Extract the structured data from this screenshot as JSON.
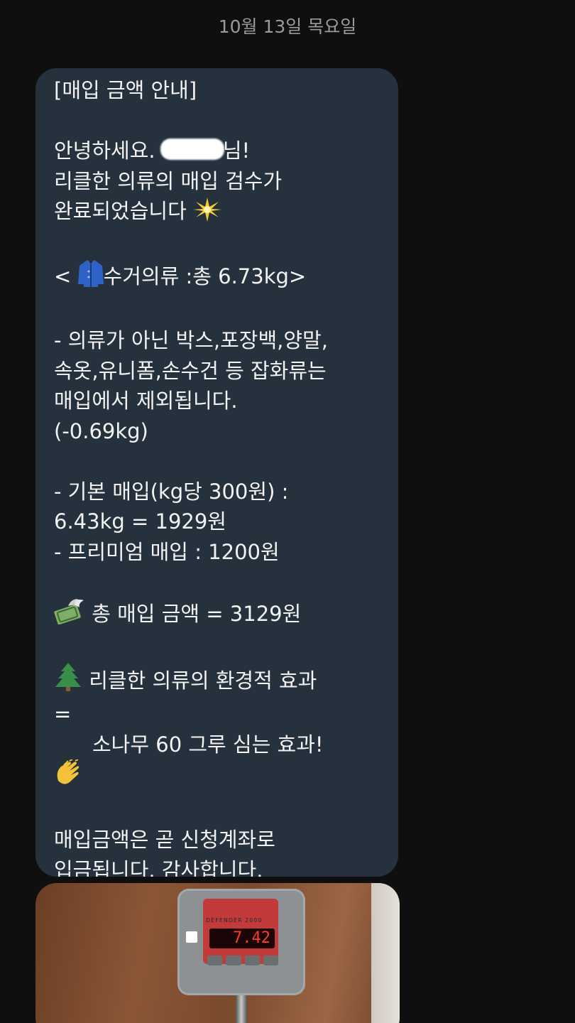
{
  "date_header": "10월 13일 목요일",
  "message": {
    "title": "[매입 금액 안내]",
    "greeting_prefix": "안녕하세요. ",
    "greeting_suffix": "님!",
    "line_review_1": "리클한 의류의 매입 검수가",
    "line_review_2": "완료되었습니다 ",
    "collected": "< ",
    "collected_text": "수거의류 :총 6.73kg>",
    "excluded_1": "- 의류가 아닌 박스,포장백,양말,",
    "excluded_2": "속옷,유니폼,손수건 등 잡화류는",
    "excluded_3": "매입에서 제외됩니다.",
    "excluded_4": "(-0.69kg)",
    "basic_1": "- 기본 매입(kg당 300원) :",
    "basic_2": "6.43kg = 1929원",
    "premium": "- 프리미엄 매입 : 1200원",
    "total": " 총 매입 금액 = 3129원",
    "eco_1": " 리클한 의류의 환경적 효과",
    "eco_2": "=",
    "eco_3": "소나무 60 그루 심는 효과!",
    "deposit_1": "매입금액은 곧 신청계좌로",
    "deposit_2": "입금됩니다. 감사합니다."
  },
  "icons": {
    "sparkle": "sparkle-icon",
    "jacket": "jacket-icon",
    "money": "money-with-wings-icon",
    "tree": "evergreen-tree-icon",
    "clap": "clapping-hands-icon"
  },
  "photo": {
    "brand": "DEFENDER 2000",
    "display_value": "7.42"
  }
}
